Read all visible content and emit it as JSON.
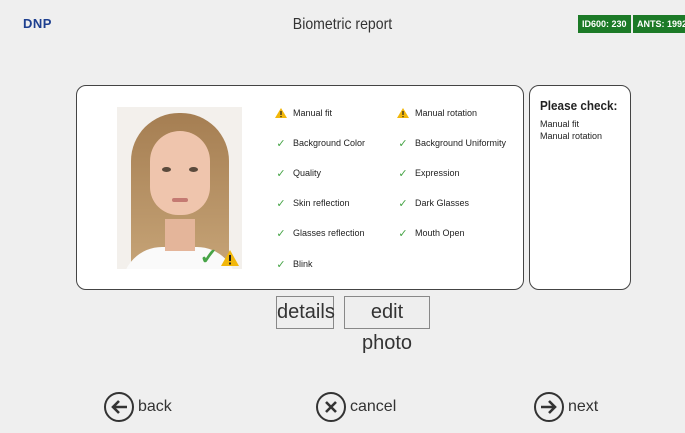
{
  "header": {
    "logo": "DNP",
    "title": "Biometric report",
    "badges": [
      "ID600: 230",
      "ANTS: 1992"
    ],
    "badge_color": "#1c7a27"
  },
  "checks": {
    "left": [
      {
        "label": "Manual fit",
        "status": "warning"
      },
      {
        "label": "Background Color",
        "status": "ok"
      },
      {
        "label": "Quality",
        "status": "ok"
      },
      {
        "label": "Skin reflection",
        "status": "ok"
      },
      {
        "label": "Glasses reflection",
        "status": "ok"
      },
      {
        "label": "Blink",
        "status": "ok"
      }
    ],
    "right": [
      {
        "label": "Manual rotation",
        "status": "warning"
      },
      {
        "label": "Background Uniformity",
        "status": "ok"
      },
      {
        "label": "Expression",
        "status": "ok"
      },
      {
        "label": "Dark Glasses",
        "status": "ok"
      },
      {
        "label": "Mouth Open",
        "status": "ok"
      }
    ]
  },
  "please_check": {
    "title": "Please check:",
    "items": [
      "Manual fit",
      "Manual rotation"
    ]
  },
  "actions": {
    "details": "details",
    "edit_photo": "edit photo"
  },
  "nav": {
    "back": "back",
    "cancel": "cancel",
    "next": "next"
  },
  "icons": {
    "ok": "check-icon",
    "warning": "warning-icon",
    "ok_color": "#47a447",
    "warning_color": "#f2b70a"
  }
}
